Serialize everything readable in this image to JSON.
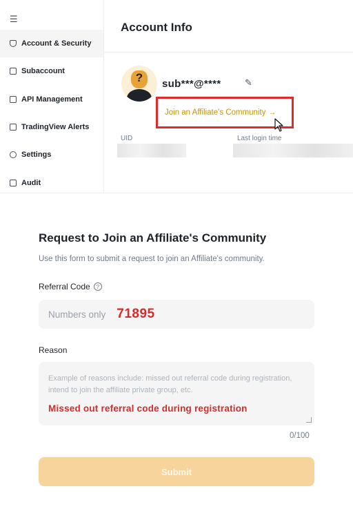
{
  "sidebar": {
    "menu_icon": "menu-icon",
    "items": [
      {
        "label": "Account & Security",
        "icon": "shield-icon",
        "active": true
      },
      {
        "label": "Subaccount",
        "icon": "subaccount-icon"
      },
      {
        "label": "API Management",
        "icon": "api-icon"
      },
      {
        "label": "TradingView Alerts",
        "icon": "tradingview-icon"
      },
      {
        "label": "Settings",
        "icon": "gear-icon"
      },
      {
        "label": "Audit",
        "icon": "clipboard-icon"
      }
    ]
  },
  "account": {
    "title": "Account Info",
    "username": "sub***@****",
    "affiliate_link": "Join an Affiliate's Community",
    "affiliate_arrow": "→",
    "uid_label": "UID",
    "last_login_label": "Last login time"
  },
  "form": {
    "title": "Request to Join an Affiliate's Community",
    "description": "Use this form to submit a request to join an Affiliate's community.",
    "referral_label": "Referral Code",
    "referral_placeholder": "Numbers only",
    "referral_value": "71895",
    "reason_label": "Reason",
    "reason_placeholder": "Example of reasons include: missed out referral code during registration, intend to join the affiliate private group, etc.",
    "reason_value": "Missed out referral code during registration",
    "char_count": "0/100",
    "submit_label": "Submit"
  },
  "colors": {
    "accent": "#c99400",
    "highlight_box": "#e32a2a",
    "annotation_text": "#d42b2b",
    "submit_disabled": "#f8d49d"
  }
}
